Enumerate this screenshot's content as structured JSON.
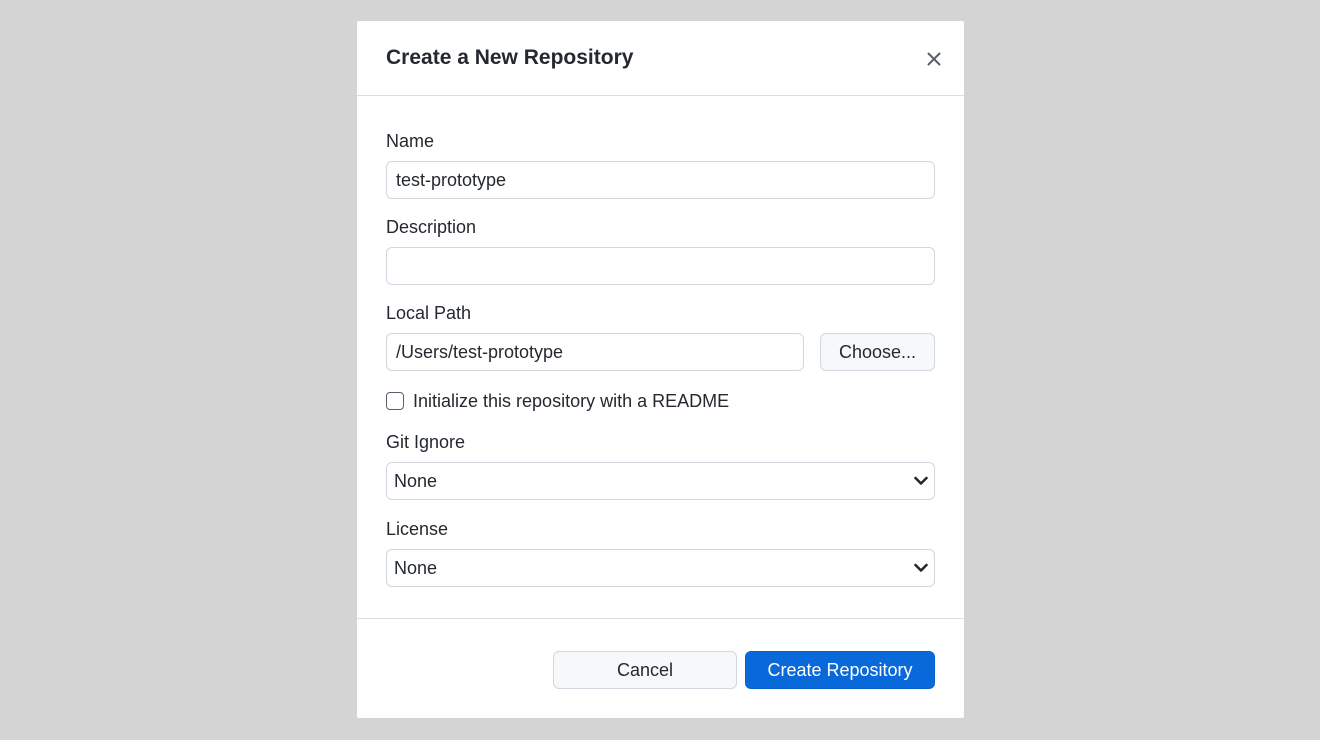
{
  "dialog": {
    "title": "Create a New Repository",
    "close_icon": "close-icon"
  },
  "form": {
    "name": {
      "label": "Name",
      "value": "test-prototype"
    },
    "description": {
      "label": "Description",
      "value": ""
    },
    "local_path": {
      "label": "Local Path",
      "value": "/Users/test-prototype",
      "choose_label": "Choose..."
    },
    "readme": {
      "label": "Initialize this repository with a README",
      "checked": false
    },
    "git_ignore": {
      "label": "Git Ignore",
      "selected": "None",
      "icon": "chevron-down-icon"
    },
    "license": {
      "label": "License",
      "selected": "None",
      "icon": "chevron-down-icon"
    }
  },
  "footer": {
    "cancel_label": "Cancel",
    "create_label": "Create Repository"
  },
  "colors": {
    "background": "#d4d4d4",
    "dialog": "#ffffff",
    "primary": "#0969da",
    "border": "#d0d7de",
    "text": "#24292f"
  }
}
